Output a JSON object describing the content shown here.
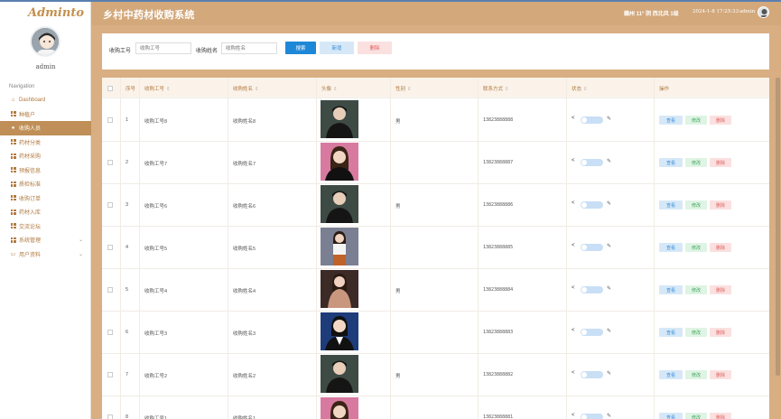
{
  "sidebar": {
    "logo": "Adminto",
    "user_name": "admin",
    "nav_heading": "Navigation",
    "items": [
      {
        "label": "Dashboard",
        "icon": "home-icon"
      },
      {
        "label": "种植户",
        "icon": "grid-icon"
      },
      {
        "label": "收购人员",
        "icon": "user-icon",
        "active": true
      },
      {
        "label": "药材分类",
        "icon": "grid-icon"
      },
      {
        "label": "药材采购",
        "icon": "grid-icon"
      },
      {
        "label": "预报信息",
        "icon": "grid-icon"
      },
      {
        "label": "质检标准",
        "icon": "grid-icon"
      },
      {
        "label": "收购订单",
        "icon": "grid-icon"
      },
      {
        "label": "药材入库",
        "icon": "grid-icon"
      },
      {
        "label": "交流论坛",
        "icon": "grid-icon"
      },
      {
        "label": "系统管理",
        "icon": "grid-icon",
        "chevron": true
      },
      {
        "label": "用户资料",
        "icon": "calendar-icon",
        "chevron": true
      }
    ]
  },
  "header": {
    "title": "乡村中药材收购系统",
    "weather": "赣州 11° 阴 西北风 1级",
    "datetime": "2024-1-8 17:25:33",
    "admin": "admin"
  },
  "search": {
    "label_id": "收购工号",
    "placeholder_id": "收购工号",
    "label_name": "收购姓名",
    "placeholder_name": "收购姓名",
    "btn_search": "搜索",
    "btn_add": "新增",
    "btn_delete": "删除"
  },
  "table": {
    "columns": [
      "序号",
      "收购工号",
      "收购姓名",
      "头像",
      "性别",
      "联系方式",
      "状态",
      "操作"
    ],
    "actions": {
      "view": "查看",
      "edit": "修改",
      "delete": "删除"
    },
    "rows": [
      {
        "index": "1",
        "id": "收购工号8",
        "name": "收购姓名8",
        "gender": "男",
        "phone": "13823888888",
        "photo": "male"
      },
      {
        "index": "2",
        "id": "收购工号7",
        "name": "收购姓名7",
        "gender": "",
        "phone": "13823888887",
        "photo": "female-pink"
      },
      {
        "index": "3",
        "id": "收购工号6",
        "name": "收购姓名6",
        "gender": "男",
        "phone": "13823888886",
        "photo": "male"
      },
      {
        "index": "4",
        "id": "收购工号5",
        "name": "收购姓名5",
        "gender": "",
        "phone": "13823888885",
        "photo": "female-white"
      },
      {
        "index": "5",
        "id": "收购工号4",
        "name": "收购姓名4",
        "gender": "男",
        "phone": "13823888884",
        "photo": "female-coat"
      },
      {
        "index": "6",
        "id": "收购工号3",
        "name": "收购姓名3",
        "gender": "",
        "phone": "13823888883",
        "photo": "female-suit"
      },
      {
        "index": "7",
        "id": "收购工号2",
        "name": "收购姓名2",
        "gender": "男",
        "phone": "13823888882",
        "photo": "male"
      },
      {
        "index": "8",
        "id": "收购工号1",
        "name": "收购姓名1",
        "gender": "",
        "phone": "13823888881",
        "photo": "female-pink"
      }
    ]
  },
  "colors": {
    "header": "#d3a87b",
    "content_bg": "#d8ae82",
    "sidebar_active": "#bf8f57",
    "accent_text": "#b07a40",
    "primary": "#1e88d8"
  }
}
